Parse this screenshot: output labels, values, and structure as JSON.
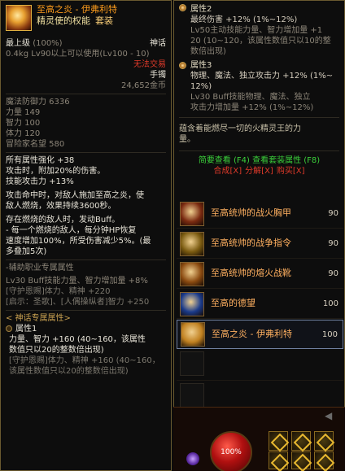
{
  "item": {
    "name": "至高之炎 - 伊弗利特",
    "subtitle": "精灵使的权能",
    "set_tag": "套装",
    "grade": "最上级",
    "grade_pct": "(100%)",
    "rarity": "神话",
    "weight_level": "0.4kg  Lv90以上可以使用(Lv100 - 10)",
    "trade": "无法交易",
    "slot": "手镯",
    "price": "24,652金币",
    "stats": [
      {
        "label": "魔法防御力",
        "value": "6336"
      },
      {
        "label": "力量",
        "value": "149"
      },
      {
        "label": "智力",
        "value": "100"
      },
      {
        "label": "体力",
        "value": "120"
      },
      {
        "label": "冒险家名望",
        "value": "580"
      }
    ],
    "effects": [
      "所有属性强化 +38",
      "攻击时，附加20%的伤害。",
      "技能攻击力 +13%"
    ],
    "proc1": [
      "攻击命中时，对敌人施加至高之炎，使",
      "敌人燃烧，效果持续3600秒。"
    ],
    "proc2": [
      "存在燃烧的敌人时，发动Buff。",
      "- 每一个燃烧的敌人，每分钟HP恢复",
      "速度增加100%，所受伤害减少5%。(最",
      "多叠加5次)"
    ],
    "aux_title": "-辅助职业专属属性",
    "aux_lines": [
      "Lv30 Buff技能力量、智力增加量 +8%",
      "[守护恩赐]体力、精神 +220",
      "[启示：圣歌]、[人偶操纵者]智力 +250"
    ],
    "myth_title": "< 神话专属属性>",
    "myth_attr1_title": "属性1",
    "myth_attr1": [
      "力量、智力 +160 (40~160，该属性",
      "数值只以20的整数倍出现)"
    ],
    "myth_attr1_gray": [
      "[守护恩赐]体力、精神 +160 (40~160，",
      "该属性数值只以20的整数倍出现)"
    ]
  },
  "right": {
    "attr2_title": "属性2",
    "attr2": [
      "最终伤害 +12% (1%~12%)"
    ],
    "attr2_gray": [
      "Lv50主动技能力量、智力增加量 +1",
      "20 (10~120，该属性数值只以10的整",
      "数倍出现)"
    ],
    "attr3_title": "属性3",
    "attr3": [
      "物理、魔法、独立攻击力 +12% (1%~",
      "12%)"
    ],
    "attr3_gray": [
      "Lv30 Buff技能物理、魔法、独立",
      "攻击力增加量 +12% (1%~12%)"
    ],
    "flavor": [
      "蕴含着能燃尽一切的火精灵王的力",
      "量。"
    ],
    "set_view": "简要查看 (F4) 查看套装属性 (F8)",
    "link_compose": "合成[X]",
    "link_unlock": "分解[X]",
    "link_buy": "购买[X]",
    "set_items": [
      {
        "name": "至高统帅的战火胸甲",
        "level": "90",
        "active": false,
        "color": "#7a2a10"
      },
      {
        "name": "至高统帅的战争指令",
        "level": "90",
        "active": false,
        "color": "#7a5a10"
      },
      {
        "name": "至高统帅的熔火战靴",
        "level": "90",
        "active": false,
        "color": "#8a4a10"
      },
      {
        "name": "至高的德望",
        "level": "100",
        "active": false,
        "color": "#1a3a8a"
      },
      {
        "name": "至高之炎 - 伊弗利特",
        "level": "100",
        "active": true,
        "color": "#c08020"
      }
    ],
    "hp_pct": "100%",
    "scroll_arrow": "◀"
  },
  "colors": {
    "orange": "#ff9d1c",
    "red": "#e03a2a",
    "green": "#3ad03a",
    "frame": "#6a5a30"
  }
}
